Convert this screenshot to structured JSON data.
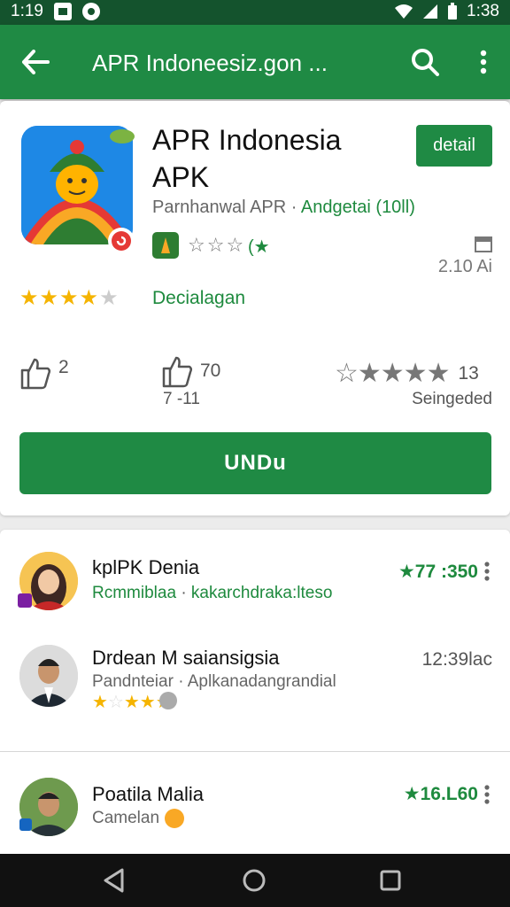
{
  "status_bar": {
    "time_left": "1:19",
    "time_right": "1:38"
  },
  "app_bar": {
    "title": "APR Indoneesiz.gon ...",
    "back_icon": "arrow-back-icon",
    "search_icon": "search-icon",
    "more_icon": "more-vert-icon"
  },
  "app": {
    "name_line1": "APR Indonesia",
    "name_line2": "APK",
    "developer": "Parnhanwal APR",
    "category": "Andgetai (10ll)",
    "mini_rating_text": "(★",
    "size_text": "2.10 Ai",
    "rating_stars": 4,
    "rating_label": "Decialagan",
    "detail_button": "detail",
    "likes": "2",
    "thumbs_count": "70",
    "thumbs_sub": "7 -11",
    "score": "13",
    "score_label": "Seingeded",
    "install_button": "UNDu"
  },
  "reviews": [
    {
      "name": "kplPK Denia",
      "sub_left": "Rcmmiblaa",
      "sub_right": "kakarchdraka:lteso",
      "score": "★77 :350",
      "stars": 0
    },
    {
      "name": "Drdean M saiansigsia",
      "sub_left": "Pandnteiar",
      "sub_right": "Aplkanadangrandial",
      "time": "12:39lac",
      "stars": 4
    },
    {
      "name": "Poatila Malia",
      "sub_left": "Camelan",
      "score": "★16.L60",
      "stars": 0
    }
  ],
  "colors": {
    "primary": "#1f8a44",
    "status": "#14532d",
    "star": "#f5b400"
  }
}
